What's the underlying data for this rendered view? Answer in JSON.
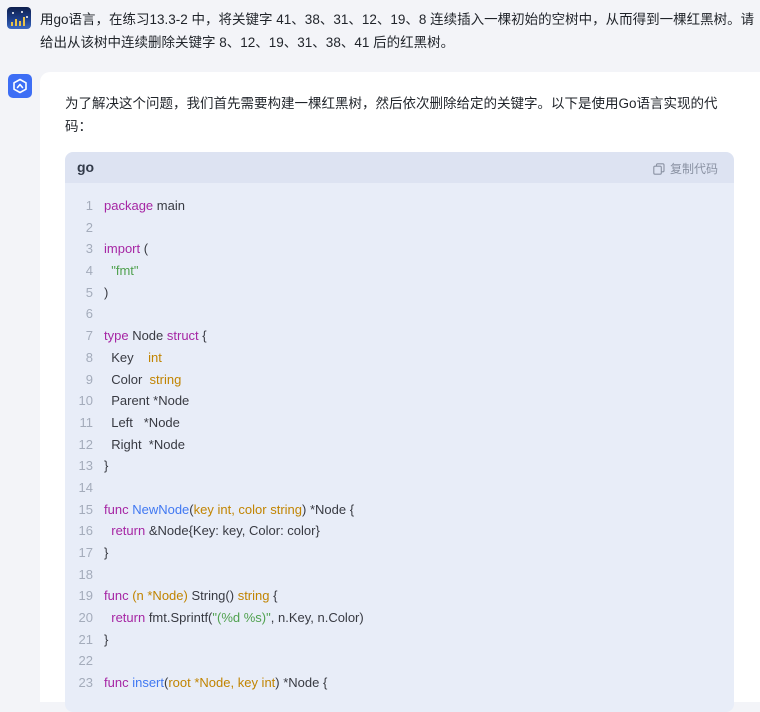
{
  "question": {
    "text": "用go语言，在练习13.3-2 中，将关键字 41、38、31、12、19、8 连续插入一棵初始的空树中，从而得到一棵红黑树。请给出从该树中连续删除关键字 8、12、19、31、38、41 后的红黑树。"
  },
  "answer": {
    "intro": "为了解决这个问题，我们首先需要构建一棵红黑树，然后依次删除给定的关键字。以下是使用Go语言实现的代码："
  },
  "code": {
    "language": "go",
    "copy_label": "复制代码",
    "lines": [
      {
        "n": "1",
        "html": "<span class=\"kw\">package</span> main"
      },
      {
        "n": "2",
        "html": ""
      },
      {
        "n": "3",
        "html": "<span class=\"kw\">import</span> ("
      },
      {
        "n": "4",
        "html": "  <span class=\"st\">\"fmt\"</span>"
      },
      {
        "n": "5",
        "html": ")"
      },
      {
        "n": "6",
        "html": ""
      },
      {
        "n": "7",
        "html": "<span class=\"kw\">type</span> Node <span class=\"kw\">struct</span> {"
      },
      {
        "n": "8",
        "html": "  Key    <span class=\"ty\">int</span>"
      },
      {
        "n": "9",
        "html": "  Color  <span class=\"ty\">string</span>"
      },
      {
        "n": "10",
        "html": "  Parent *Node"
      },
      {
        "n": "11",
        "html": "  Left   *Node"
      },
      {
        "n": "12",
        "html": "  Right  *Node"
      },
      {
        "n": "13",
        "html": "}"
      },
      {
        "n": "14",
        "html": ""
      },
      {
        "n": "15",
        "html": "<span class=\"kw\">func</span> <span class=\"fn\">NewNode</span>(<span class=\"pm\">key int, color string</span>) *Node {"
      },
      {
        "n": "16",
        "html": "  <span class=\"kw\">return</span> &amp;Node{Key: key, Color: color}"
      },
      {
        "n": "17",
        "html": "}"
      },
      {
        "n": "18",
        "html": ""
      },
      {
        "n": "19",
        "html": "<span class=\"kw\">func</span> <span class=\"pm\">(n *Node)</span> String() <span class=\"ty\">string</span> {"
      },
      {
        "n": "20",
        "html": "  <span class=\"kw\">return</span> fmt.Sprintf(<span class=\"st\">\"(%d %s)\"</span>, n.Key, n.Color)"
      },
      {
        "n": "21",
        "html": "}"
      },
      {
        "n": "22",
        "html": ""
      },
      {
        "n": "23",
        "html": "<span class=\"kw\">func</span> <span class=\"fn\">insert</span>(<span class=\"pm\">root *Node, key int</span>) *Node {"
      }
    ]
  }
}
